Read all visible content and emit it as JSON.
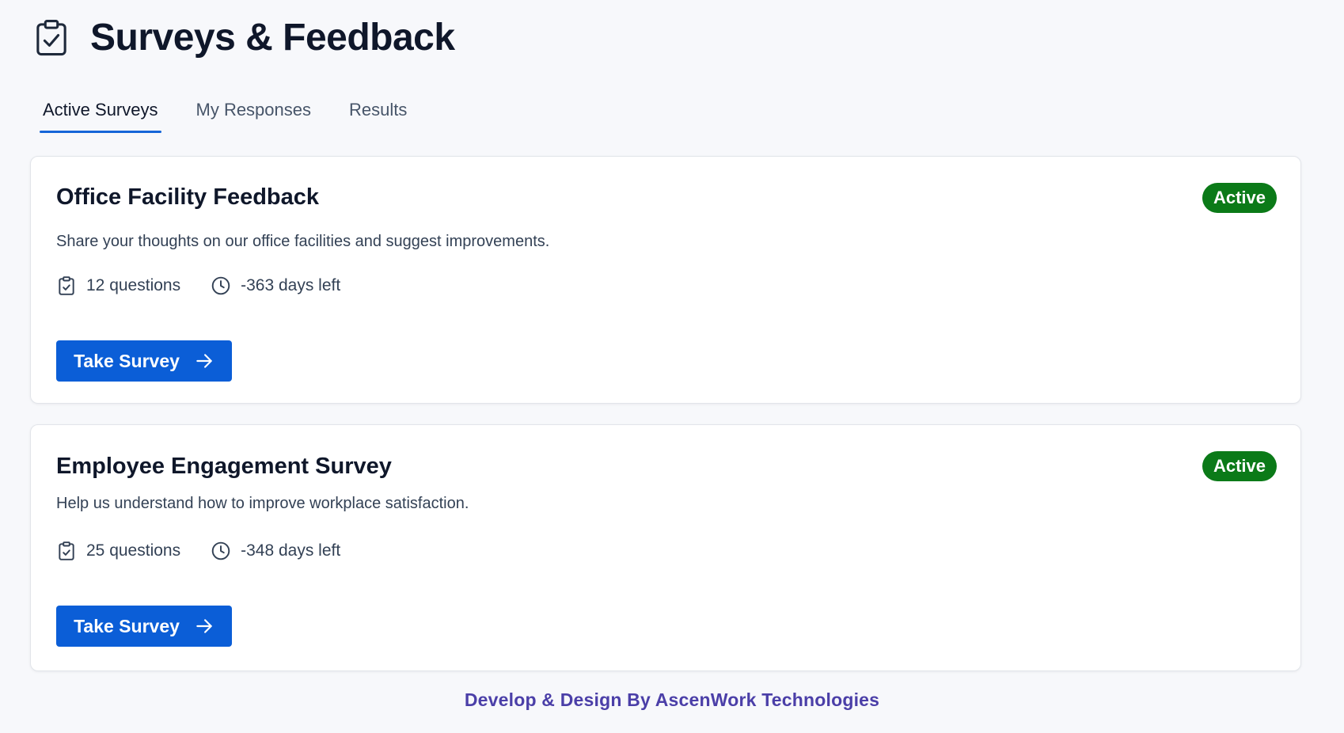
{
  "header": {
    "title": "Surveys & Feedback",
    "icon": "clipboard-check-icon"
  },
  "tabs": [
    {
      "label": "Active Surveys",
      "active": true
    },
    {
      "label": "My Responses",
      "active": false
    },
    {
      "label": "Results",
      "active": false
    }
  ],
  "surveys": [
    {
      "title": "Office Facility Feedback",
      "status": "Active",
      "description": "Share your thoughts on our office facilities and suggest improvements.",
      "questions": "12 questions",
      "days_left": "-363 days left",
      "button_label": "Take Survey"
    },
    {
      "title": "Employee Engagement Survey",
      "status": "Active",
      "description": "Help us understand how to improve workplace satisfaction.",
      "questions": "25 questions",
      "days_left": "-348 days left",
      "button_label": "Take Survey"
    }
  ],
  "footer": {
    "text": "Develop & Design By AscenWork Technologies"
  },
  "colors": {
    "accent": "#0b5ed7",
    "tab_underline": "#1565d8",
    "active_badge": "#0b7a18",
    "footer_text": "#4b3fa8"
  }
}
